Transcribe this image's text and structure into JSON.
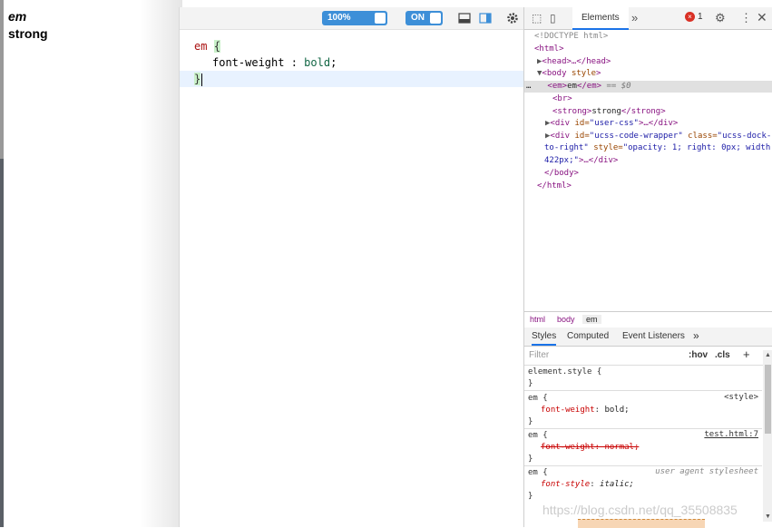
{
  "page": {
    "em_text": "em",
    "strong_text": "strong"
  },
  "editor": {
    "zoom_label": "100%",
    "toggle_label": "ON",
    "code": {
      "selector": "em",
      "open": "{",
      "prop": "font-weight",
      "sep": " : ",
      "value": "bold",
      "semi": ";",
      "close": "}"
    }
  },
  "devtools": {
    "tab_elements": "Elements",
    "more_tabs": "»",
    "error_count": "1",
    "dom": {
      "doctype": "<!DOCTYPE html>",
      "html_open": "<html>",
      "head": "<head>…</head>",
      "body_open_tag": "<body ",
      "body_attr": "style",
      "body_close_bracket": ">",
      "em_open": "<em>",
      "em_text": "em",
      "em_close": "</em>",
      "eq0": " == $0",
      "ellipsis": "…",
      "br": "<br>",
      "strong_open": "<strong>",
      "strong_text": "strong",
      "strong_close": "</strong>",
      "div1_open": "<div ",
      "div1_attr": "id=",
      "div1_val": "\"user-css\"",
      "div1_rest": ">…</div>",
      "div2_open": "<div ",
      "div2_attr1": "id=",
      "div2_val1": "\"ucss-code-wrapper\"",
      "div2_attr2": " class=",
      "div2_val2": "\"ucss-dock-",
      "div2_line2_val": "to-right\"",
      "div2_attr3": " style=",
      "div2_val3": "\"opacity: 1; right: 0px; width:",
      "div2_line3_val": "422px;\"",
      "div2_rest": ">…</div>",
      "body_close": "</body>",
      "html_close": "</html>"
    },
    "breadcrumb": [
      "html",
      "body",
      "em"
    ],
    "style_tabs": [
      "Styles",
      "Computed",
      "Event Listeners",
      "»"
    ],
    "filter_placeholder": "Filter",
    "hov": ":hov",
    "cls": ".cls",
    "plus": "+",
    "rules": {
      "r1_sel": "element.style {",
      "r1_close": "}",
      "r2_sel": "em {",
      "r2_src": "<style>",
      "r2_prop": "font-weight",
      "r2_val": "bold;",
      "r2_close": "}",
      "r3_sel": "em {",
      "r3_src": "test.html:7",
      "r3_decl": "font-weight: normal;",
      "r3_close": "}",
      "r4_sel": "em {",
      "r4_src": "user agent stylesheet",
      "r4_prop": "font-style",
      "r4_val": "italic;",
      "r4_close": "}"
    }
  },
  "watermark": "https://blog.csdn.net/qq_35508835"
}
